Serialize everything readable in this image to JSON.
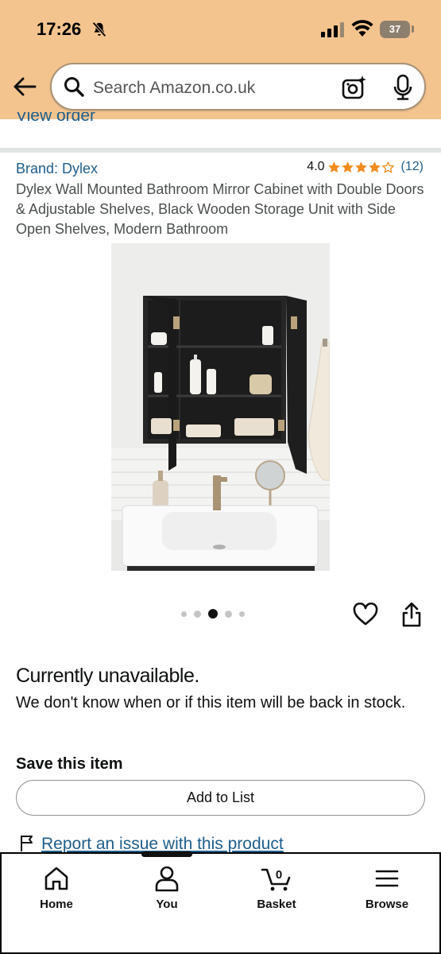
{
  "status_bar": {
    "time": "17:26",
    "battery": "37",
    "icons": [
      "bell-slash-icon",
      "signal-icon",
      "wifi-icon",
      "battery-icon"
    ]
  },
  "search": {
    "placeholder": "Search Amazon.co.uk",
    "icons": [
      "back-arrow-icon",
      "search-icon",
      "camera-icon",
      "mic-icon"
    ]
  },
  "orders": {
    "view_order_label": "View order"
  },
  "product": {
    "brand_label": "Brand: Dylex",
    "rating_value": "4.0",
    "rating_stars": 4,
    "rating_count": "(12)",
    "title": "Dylex Wall Mounted Bathroom Mirror Cabinet with Double Doors & Adjustable Shelves, Black Wooden Storage Unit with Side Open Shelves, Modern Bathroom",
    "image_count": 5,
    "active_image_index": 2
  },
  "availability": {
    "status": "Currently unavailable.",
    "note": "We don't know when or if this item will be back in stock."
  },
  "save": {
    "heading": "Save this item",
    "add_to_list_label": "Add to List"
  },
  "report": {
    "link_label": "Report an issue with this product"
  },
  "bottom_nav": {
    "items": [
      {
        "label": "Home",
        "icon": "home-icon"
      },
      {
        "label": "You",
        "icon": "person-icon"
      },
      {
        "label": "Basket",
        "icon": "cart-icon",
        "count": "0"
      },
      {
        "label": "Browse",
        "icon": "menu-icon"
      }
    ]
  },
  "colors": {
    "header_bg": "#f4c48f",
    "link": "#1f5e8c",
    "star": "#f08c1e"
  }
}
